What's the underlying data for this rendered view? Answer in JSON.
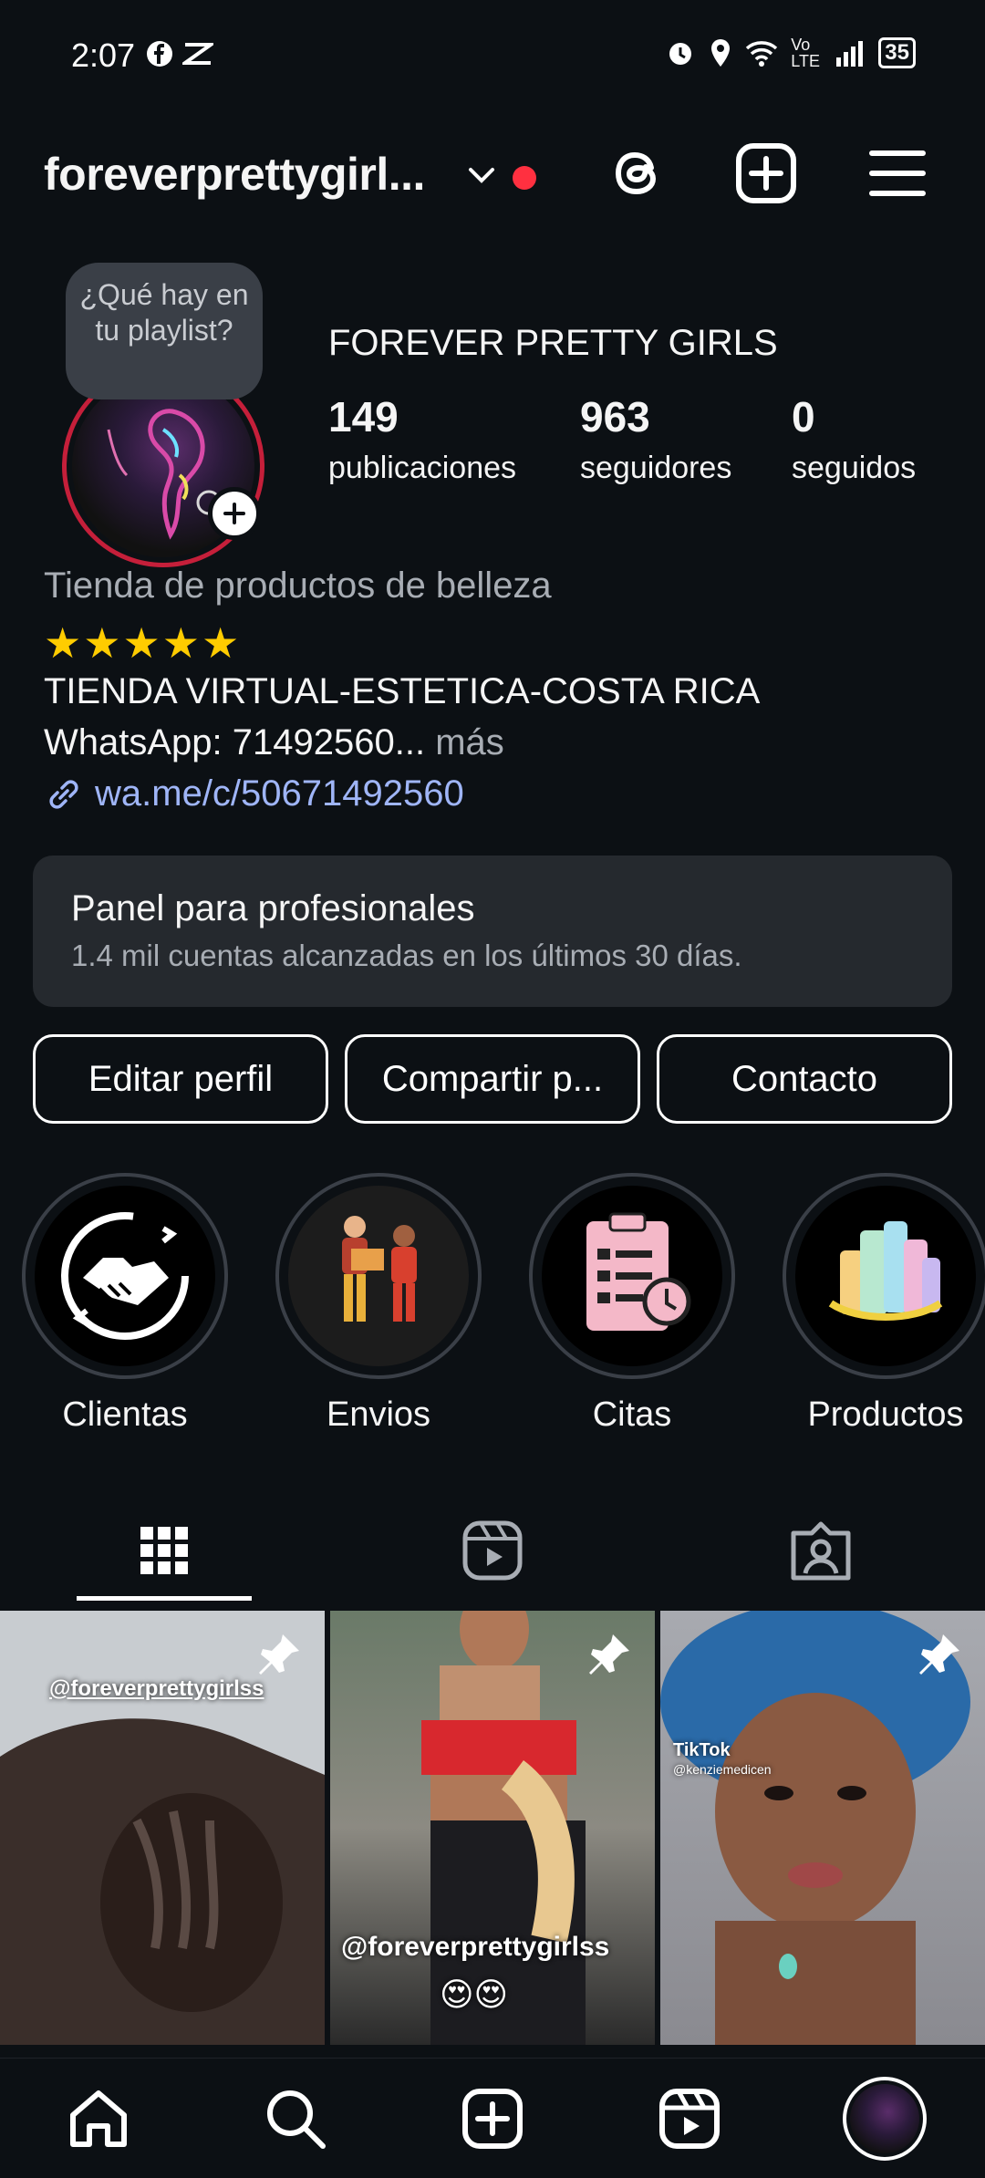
{
  "status": {
    "time": "2:07",
    "battery": "35",
    "network": "Vo LTE"
  },
  "header": {
    "username": "foreverprettygirl..."
  },
  "note": {
    "text": "¿Qué hay en tu playlist?"
  },
  "profile": {
    "display_name": "FOREVER PRETTY GIRLS",
    "stats": [
      {
        "value": "149",
        "label": "publicaciones"
      },
      {
        "value": "963",
        "label": "seguidores"
      },
      {
        "value": "0",
        "label": "seguidos"
      }
    ],
    "category": "Tienda de productos de belleza",
    "stars": "★★★★★",
    "bio_line1": "TIENDA VIRTUAL-ESTETICA-COSTA RICA",
    "bio_line2": "WhatsApp: 71492560...",
    "bio_more": "más",
    "link": "wa.me/c/50671492560"
  },
  "pro_panel": {
    "title": "Panel para profesionales",
    "subtitle": "1.4 mil cuentas alcanzadas en los últimos 30 días."
  },
  "buttons": {
    "edit": "Editar perfil",
    "share": "Compartir p...",
    "contact": "Contacto"
  },
  "highlights": [
    {
      "label": "Clientas"
    },
    {
      "label": "Envios"
    },
    {
      "label": "Citas"
    },
    {
      "label": "Productos"
    }
  ],
  "posts": [
    {
      "overlay": "@foreverprettygirlss"
    },
    {
      "overlay": "@foreverprettygirlss"
    },
    {
      "overlay": "TikTok",
      "overlay2": "@kenziemedicen"
    }
  ],
  "colors": {
    "background": "#0c1014",
    "accent_red": "#ff3040",
    "link": "#9fb5f7",
    "stars": "#ffcc00"
  }
}
